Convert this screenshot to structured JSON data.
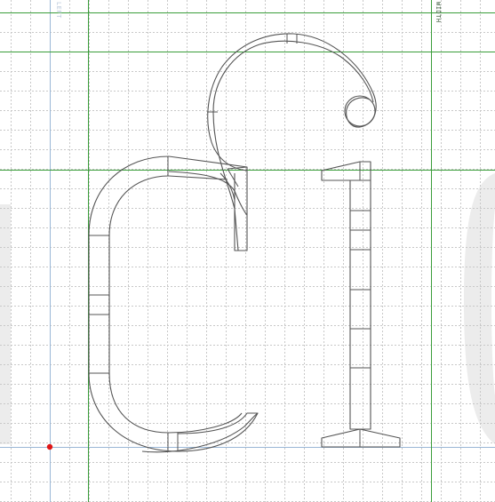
{
  "guides": {
    "left_label": "LEFT",
    "width_label": "WIDTH"
  },
  "colors": {
    "background": "#ffffff",
    "grid_dotted": "#c8c8c8",
    "grid_major": "#3a9d3a",
    "metric_line": "#9ab7d6",
    "outline": "#555555",
    "ghost_glyph": "#ececec",
    "origin_point": "#e01515"
  },
  "glyphs": {
    "ligature": "ƒi",
    "ghost_left": "l",
    "ghost_right": "c"
  }
}
